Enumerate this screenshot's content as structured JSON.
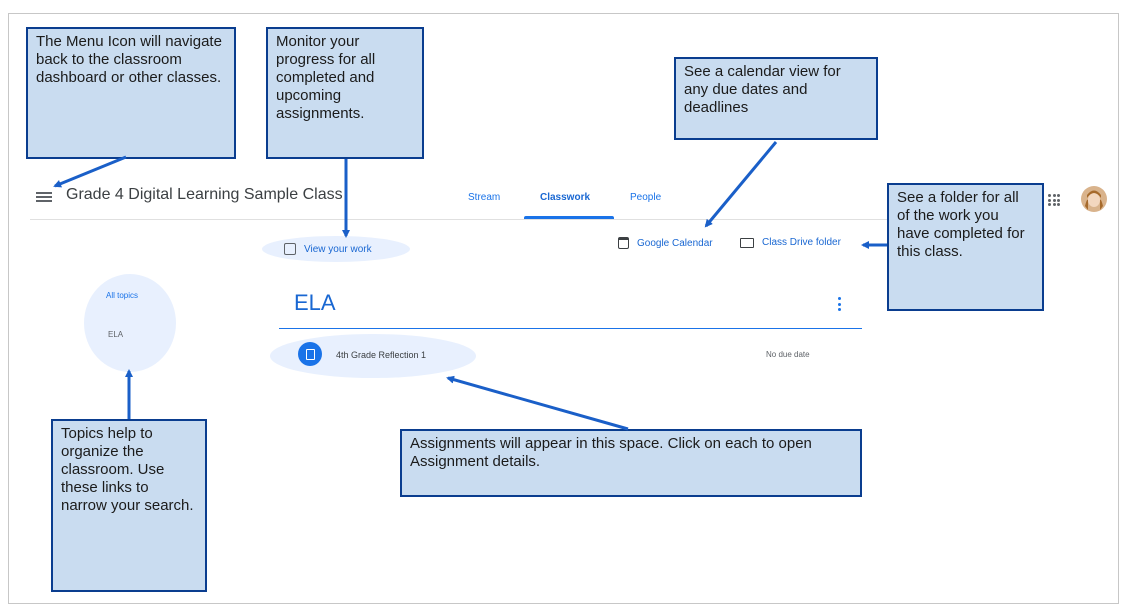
{
  "header": {
    "class_title": "Grade 4 Digital Learning Sample Class",
    "tabs": [
      {
        "label": "Stream"
      },
      {
        "label": "Classwork"
      },
      {
        "label": "People"
      }
    ],
    "active_tab": "Classwork"
  },
  "toolbar": {
    "view_work_label": "View your work",
    "google_calendar_label": "Google Calendar",
    "class_drive_label": "Class Drive folder"
  },
  "topics": {
    "all_label": "All topics",
    "items": [
      {
        "label": "ELA"
      }
    ]
  },
  "section": {
    "title": "ELA",
    "assignments": [
      {
        "title": "4th Grade Reflection 1",
        "due": "No due date"
      }
    ]
  },
  "callouts": {
    "menu": "The Menu Icon will navigate back to the classroom dashboard or other classes.",
    "progress": "Monitor your progress for all completed and upcoming assignments.",
    "calendar": "See a calendar view for any due dates and deadlines",
    "folder": "See a folder for all of the work you have completed for this class.",
    "topics": "Topics help to organize the classroom. Use these links to narrow your search.",
    "assignments": "Assignments will appear in this space.  Click on each to open Assignment details."
  },
  "colors": {
    "accent": "#1a73e8",
    "callout_fill": "#c9dcf0",
    "callout_border": "#0a3d8f",
    "arrow": "#1a5fc8"
  },
  "icons": [
    "menu-icon",
    "apps-icon",
    "avatar",
    "assignment-icon",
    "calendar-icon",
    "folder-icon",
    "view-work-icon",
    "more-vert-icon"
  ]
}
